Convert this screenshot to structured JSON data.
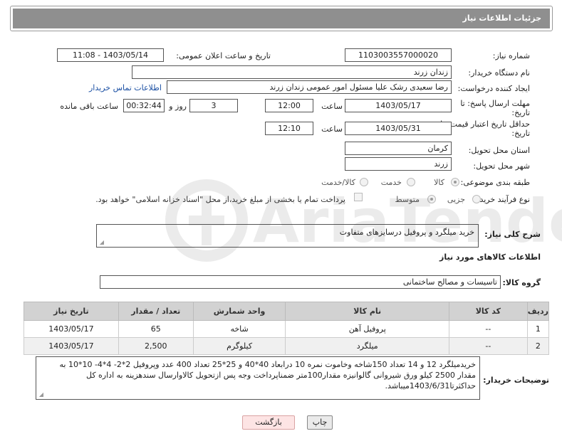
{
  "panel": {
    "title": "جزئیات اطلاعات نیاز"
  },
  "fields": {
    "need_number_label": "شماره نیاز:",
    "need_number": "1103003557000020",
    "announce_label": "تاریخ و ساعت اعلان عمومی:",
    "announce_value": "1403/05/14 - 11:08",
    "buyer_org_label": "نام دستگاه خریدار:",
    "buyer_org": "زندان زرند",
    "requester_label": "ایجاد کننده درخواست:",
    "requester": "رضا سعیدی رشک علیا مسئول امور عمومی زندان زرند",
    "contact_link": "اطلاعات تماس خریدار",
    "deadline_label_1": "مهلت ارسال پاسخ: تا",
    "deadline_label_2": "تاریخ:",
    "deadline_date": "1403/05/17",
    "time_label": "ساعت",
    "deadline_time": "12:00",
    "days_value": "3",
    "days_label": "روز و",
    "remaining_time": "00:32:44",
    "remaining_label": "ساعت باقی مانده",
    "validity_label_1": "حداقل تاریخ اعتبار قیمت: تا",
    "validity_label_2": "تاریخ:",
    "validity_date": "1403/05/31",
    "validity_time": "12:10",
    "province_label": "استان محل تحویل:",
    "province": "کرمان",
    "city_label": "شهر محل تحویل:",
    "city": "زرند",
    "category_label": "طبقه بندی موضوعی:",
    "category_options": [
      "کالا",
      "خدمت",
      "کالا/خدمت"
    ],
    "process_label": "نوع فرآیند خرید :",
    "process_options": [
      "جزیی",
      "متوسط"
    ],
    "payment_note": "پرداخت تمام یا بخشی از مبلغ خرید،از محل \"اسناد خزانه اسلامی\" خواهد بود.",
    "summary_label": "شرح کلی نیاز:",
    "summary": "خرید میلگرد و پروفیل درسایزهای متفاوت",
    "goods_info_title": "اطلاعات کالاهای مورد نیاز",
    "goods_group_label": "گروه کالا:",
    "goods_group": "تاسیسات و مصالح ساختمانی",
    "buyer_notes_label": "توضیحات خریدار:",
    "buyer_notes": "خریدمیلگرد 12 و 14 تعداد 150شاخه وخاموت نمره 10 درابعاد 40*40 و 25*25 تعداد 400 عدد وپروفیل 2*2- 4*4- 10*10 به مقدار 2500 کیلو  ورق شیروانی گالوانیزه  مقدار100متر ضمناپرداخت وجه پس ازتحویل کالاوارسال سندهزینه به اداره کل حداکثرتا1403/6/31میباشد."
  },
  "table": {
    "headers": [
      "ردیف",
      "کد کالا",
      "نام کالا",
      "واحد شمارش",
      "تعداد / مقدار",
      "تاریخ نیاز"
    ],
    "rows": [
      [
        "1",
        "--",
        "پروفیل آهن",
        "شاخه",
        "65",
        "1403/05/17"
      ],
      [
        "2",
        "--",
        "میلگرد",
        "کیلوگرم",
        "2,500",
        "1403/05/17"
      ]
    ]
  },
  "buttons": {
    "print": "چاپ",
    "back": "بازگشت"
  },
  "watermark": {
    "text": "AriaTender.net"
  },
  "colors": {
    "header_bg": "#8f8f8f",
    "link": "#1a4fa3",
    "table_header": "#d2d2d2",
    "back_button": "#fde4e4"
  }
}
